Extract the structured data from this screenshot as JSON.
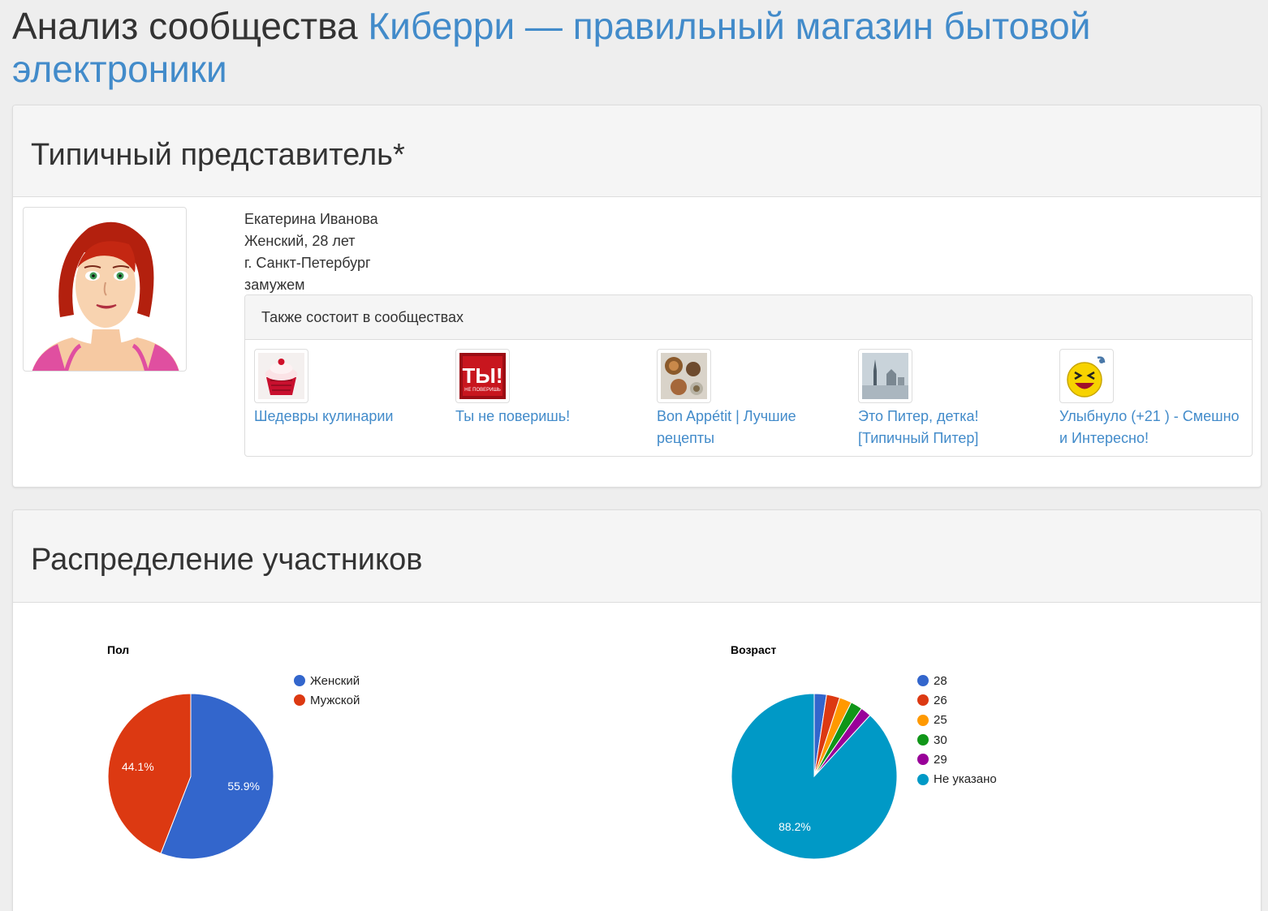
{
  "header": {
    "title_prefix": "Анализ сообщества",
    "community_name": "Киберри — правильный магазин бытовой электроники"
  },
  "typical": {
    "heading": "Типичный представитель*",
    "name": "Екатерина Иванова",
    "gender_age": "Женский, 28 лет",
    "city": "г. Санкт-Петербург",
    "status": "замужем",
    "groups_heading": "Также состоит в сообществах",
    "groups": [
      {
        "name": "Шедевры кулинарии"
      },
      {
        "name": "Ты не поверишь!"
      },
      {
        "name": "Bon Appétit | Лучшие рецепты"
      },
      {
        "name": "Это Питер, детка! [Типичный Питер]"
      },
      {
        "name": "Улыбнуло (+21 ) - Смешно и Интересно!"
      }
    ]
  },
  "distribution": {
    "heading": "Распределение участников"
  },
  "chart_data": [
    {
      "type": "pie",
      "title": "Пол",
      "legend_position": "right",
      "slices": [
        {
          "label": "Женский",
          "value": 55.9,
          "color": "#3366cc",
          "display": "55.9%"
        },
        {
          "label": "Мужской",
          "value": 44.1,
          "color": "#dc3912",
          "display": "44.1%"
        }
      ]
    },
    {
      "type": "pie",
      "title": "Возраст",
      "legend_position": "right",
      "slices": [
        {
          "label": "28",
          "value": 2.4,
          "color": "#3366cc",
          "display": ""
        },
        {
          "label": "26",
          "value": 2.6,
          "color": "#dc3912",
          "display": ""
        },
        {
          "label": "25",
          "value": 2.4,
          "color": "#ff9900",
          "display": ""
        },
        {
          "label": "30",
          "value": 2.3,
          "color": "#109618",
          "display": ""
        },
        {
          "label": "29",
          "value": 2.1,
          "color": "#990099",
          "display": ""
        },
        {
          "label": "Не указано",
          "value": 88.2,
          "color": "#0099c6",
          "display": "88.2%"
        }
      ]
    }
  ]
}
